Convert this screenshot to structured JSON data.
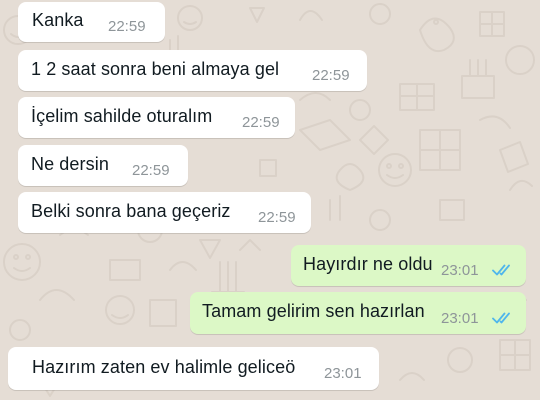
{
  "colors": {
    "incoming_bubble": "#ffffff",
    "outgoing_bubble": "#dcf8c6",
    "read_ticks": "#4fb6ec",
    "wallpaper": "#e5ddd5"
  },
  "messages": [
    {
      "direction": "in",
      "text": "Kanka",
      "time": "22:59"
    },
    {
      "direction": "in",
      "text": "1 2 saat sonra beni almaya gel",
      "time": "22:59"
    },
    {
      "direction": "in",
      "text": "İçelim sahilde oturalım",
      "time": "22:59"
    },
    {
      "direction": "in",
      "text": "Ne dersin",
      "time": "22:59"
    },
    {
      "direction": "in",
      "text": "Belki sonra bana geçeriz",
      "time": "22:59"
    },
    {
      "direction": "out",
      "text": "Hayırdır ne oldu",
      "time": "23:01",
      "status_icon": "double-check-read-icon"
    },
    {
      "direction": "out",
      "text": "Tamam gelirim sen hazırlan",
      "time": "23:01",
      "status_icon": "double-check-read-icon"
    },
    {
      "direction": "in",
      "text": "Hazırım zaten ev halimle geliceö",
      "time": "23:01"
    }
  ]
}
